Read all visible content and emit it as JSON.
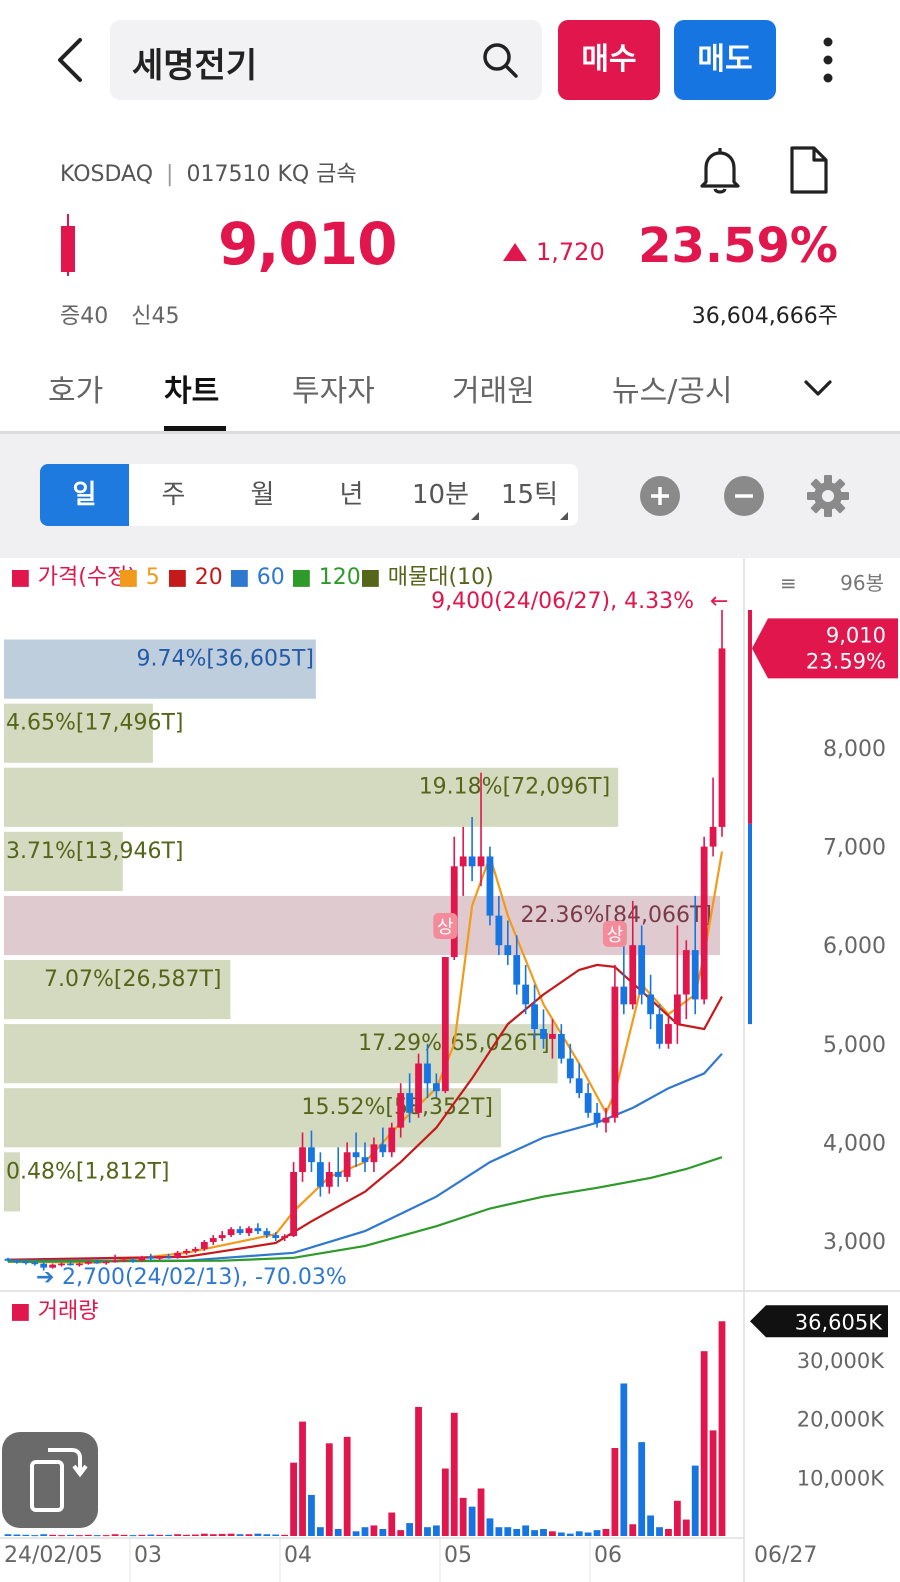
{
  "header": {
    "search_text": "세명전기",
    "buy_label": "매수",
    "sell_label": "매도",
    "icons": [
      "back-arrow-icon",
      "search-icon",
      "more-vertical-icon"
    ]
  },
  "stock": {
    "market": "KOSDAQ",
    "code_line": "017510 KQ 금속",
    "price": "9,010",
    "change": "1,720",
    "change_pct": "23.59%",
    "margin_a": "증40",
    "margin_b": "신45",
    "shares": "36,604,666주",
    "up_color": "#e0164c",
    "down_color": "#1675e0"
  },
  "tabs": [
    {
      "label": "호가",
      "active": false
    },
    {
      "label": "차트",
      "active": true
    },
    {
      "label": "투자자",
      "active": false
    },
    {
      "label": "거래원",
      "active": false
    },
    {
      "label": "뉴스/공시",
      "active": false
    }
  ],
  "periods": [
    {
      "label": "일",
      "active": true,
      "corner": false
    },
    {
      "label": "주",
      "active": false,
      "corner": false
    },
    {
      "label": "월",
      "active": false,
      "corner": false
    },
    {
      "label": "년",
      "active": false,
      "corner": false
    },
    {
      "label": "10분",
      "active": false,
      "corner": true
    },
    {
      "label": "15틱",
      "active": false,
      "corner": true
    }
  ],
  "chart_data": [
    {
      "type": "candlestick",
      "legend": [
        {
          "label": "■ 가격(수정)",
          "color": "#e0164c"
        },
        {
          "label": "■ 5",
          "color": "#f29a1c"
        },
        {
          "label": "■ 20",
          "color": "#c41a1a"
        },
        {
          "label": "■ 60",
          "color": "#2f78d0"
        },
        {
          "label": "■ 120",
          "color": "#2e9a2a"
        },
        {
          "label": "■ 매물대(10)",
          "color": "#55651a"
        }
      ],
      "bar_count_label": "96봉",
      "ylim": [
        2700,
        9600
      ],
      "y_ticks": [
        3000,
        4000,
        5000,
        6000,
        7000,
        8000
      ],
      "y_tick_labels": [
        "3,000",
        "4,000",
        "5,000",
        "6,000",
        "7,000",
        "8,000"
      ],
      "x_tick_labels": [
        "24/02/05",
        "03",
        "04",
        "05",
        "06",
        "06/27"
      ],
      "current_price_label": "9,010",
      "current_pct_label": "23.59%",
      "high_annotation": "9,400(24/06/27), 4.33%",
      "high_arrow": "←",
      "low_annotation": "2,700(24/02/13), -70.03%",
      "low_arrow": "➔",
      "limit_up_marker": "상",
      "volume_profile": [
        {
          "label": "9.74%[36,605T]",
          "low": 8500,
          "high": 9100,
          "share": 9.74,
          "color": "#b7c9d9"
        },
        {
          "label": "4.65%[17,496T]",
          "low": 7850,
          "high": 8450,
          "share": 4.65,
          "color": "#cfd6b8"
        },
        {
          "label": "19.18%[72,096T]",
          "low": 7200,
          "high": 7800,
          "share": 19.18,
          "color": "#cfd6b8"
        },
        {
          "label": "3.71%[13,946T]",
          "low": 6550,
          "high": 7150,
          "share": 3.71,
          "color": "#cfd6b8"
        },
        {
          "label": "22.36%[84,066T]",
          "low": 5900,
          "high": 6500,
          "share": 22.36,
          "color": "#dcc5ca"
        },
        {
          "label": "7.07%[26,587T]",
          "low": 5250,
          "high": 5850,
          "share": 7.07,
          "color": "#cfd6b8"
        },
        {
          "label": "17.29%[65,026T]",
          "low": 4600,
          "high": 5200,
          "share": 17.29,
          "color": "#cfd6b8"
        },
        {
          "label": "15.52%[58,352T]",
          "low": 3950,
          "high": 4550,
          "share": 15.52,
          "color": "#cfd6b8"
        },
        {
          "label": "0.48%[1,812T]",
          "low": 3300,
          "high": 3900,
          "share": 0.48,
          "color": "#cfd6b8"
        }
      ],
      "candles": [
        [
          2820,
          2830,
          2790,
          2800
        ],
        [
          2800,
          2810,
          2770,
          2790
        ],
        [
          2790,
          2800,
          2760,
          2780
        ],
        [
          2780,
          2790,
          2750,
          2770
        ],
        [
          2770,
          2780,
          2700,
          2730
        ],
        [
          2730,
          2770,
          2720,
          2760
        ],
        [
          2760,
          2780,
          2740,
          2770
        ],
        [
          2770,
          2790,
          2750,
          2760
        ],
        [
          2760,
          2780,
          2740,
          2770
        ],
        [
          2770,
          2800,
          2760,
          2790
        ],
        [
          2790,
          2810,
          2770,
          2780
        ],
        [
          2780,
          2800,
          2760,
          2790
        ],
        [
          2790,
          2860,
          2780,
          2800
        ],
        [
          2800,
          2830,
          2790,
          2810
        ],
        [
          2810,
          2830,
          2780,
          2800
        ],
        [
          2800,
          2850,
          2790,
          2840
        ],
        [
          2840,
          2870,
          2800,
          2820
        ],
        [
          2820,
          2850,
          2810,
          2840
        ],
        [
          2840,
          2870,
          2820,
          2830
        ],
        [
          2830,
          2900,
          2820,
          2880
        ],
        [
          2880,
          2920,
          2860,
          2900
        ],
        [
          2900,
          2940,
          2880,
          2920
        ],
        [
          2920,
          3010,
          2900,
          2990
        ],
        [
          2990,
          3060,
          2960,
          3030
        ],
        [
          3030,
          3100,
          3000,
          3060
        ],
        [
          3060,
          3140,
          3040,
          3120
        ],
        [
          3120,
          3150,
          3060,
          3080
        ],
        [
          3080,
          3150,
          3050,
          3130
        ],
        [
          3130,
          3180,
          3070,
          3100
        ],
        [
          3100,
          3130,
          3030,
          3060
        ],
        [
          3060,
          3090,
          3000,
          3030
        ],
        [
          3030,
          3070,
          3000,
          3050
        ],
        [
          3050,
          3800,
          3040,
          3700
        ],
        [
          3700,
          4100,
          3600,
          3950
        ],
        [
          3950,
          4120,
          3700,
          3800
        ],
        [
          3800,
          3900,
          3450,
          3550
        ],
        [
          3550,
          3800,
          3480,
          3700
        ],
        [
          3700,
          3950,
          3550,
          3650
        ],
        [
          3650,
          4000,
          3600,
          3900
        ],
        [
          3900,
          4100,
          3750,
          3850
        ],
        [
          3850,
          4000,
          3700,
          3800
        ],
        [
          3800,
          4050,
          3700,
          3980
        ],
        [
          3980,
          4150,
          3850,
          3900
        ],
        [
          3900,
          4200,
          3850,
          4150
        ],
        [
          4150,
          4600,
          4050,
          4500
        ],
        [
          4500,
          4700,
          4200,
          4300
        ],
        [
          4300,
          4900,
          4250,
          4800
        ],
        [
          4800,
          5000,
          4450,
          4600
        ],
        [
          4600,
          4700,
          4450,
          4520
        ],
        [
          4520,
          5880,
          4500,
          5880
        ],
        [
          5880,
          7100,
          5850,
          6800
        ],
        [
          6800,
          7200,
          6500,
          6900
        ],
        [
          6900,
          7300,
          6650,
          6800
        ],
        [
          6800,
          7750,
          6600,
          6900
        ],
        [
          6900,
          7000,
          6200,
          6300
        ],
        [
          6300,
          6500,
          5900,
          6000
        ],
        [
          6000,
          6250,
          5800,
          5900
        ],
        [
          5900,
          6100,
          5500,
          5600
        ],
        [
          5600,
          5800,
          5300,
          5400
        ],
        [
          5400,
          5600,
          5050,
          5150
        ],
        [
          5150,
          5350,
          4950,
          5050
        ],
        [
          5050,
          5250,
          4850,
          5100
        ],
        [
          5100,
          5200,
          4800,
          4850
        ],
        [
          4850,
          5000,
          4600,
          4650
        ],
        [
          4650,
          4800,
          4450,
          4500
        ],
        [
          4500,
          4600,
          4250,
          4300
        ],
        [
          4300,
          4400,
          4150,
          4200
        ],
        [
          4200,
          4350,
          4100,
          4250
        ],
        [
          4250,
          5800,
          4200,
          5580
        ],
        [
          5580,
          6000,
          5300,
          5400
        ],
        [
          5400,
          6450,
          5350,
          6000
        ],
        [
          6000,
          6200,
          5400,
          5500
        ],
        [
          5500,
          5700,
          5150,
          5300
        ],
        [
          5300,
          5400,
          4950,
          5000
        ],
        [
          5000,
          5300,
          4950,
          5200
        ],
        [
          5200,
          6200,
          5000,
          5500
        ],
        [
          5500,
          6050,
          5250,
          5950
        ],
        [
          5950,
          6500,
          5300,
          5450
        ],
        [
          5450,
          7100,
          5400,
          7000
        ],
        [
          7000,
          7700,
          6900,
          7200
        ],
        [
          7200,
          9400,
          7100,
          9010
        ]
      ],
      "ma_lines": [
        {
          "name": "5",
          "color": "#f29a1c",
          "points": [
            [
              0,
              2790
            ],
            [
              10,
              2780
            ],
            [
              20,
              2880
            ],
            [
              30,
              3070
            ],
            [
              32,
              3300
            ],
            [
              36,
              3650
            ],
            [
              40,
              3800
            ],
            [
              44,
              4200
            ],
            [
              48,
              4550
            ],
            [
              50,
              5000
            ],
            [
              52,
              6400
            ],
            [
              54,
              6900
            ],
            [
              56,
              6300
            ],
            [
              60,
              5400
            ],
            [
              64,
              4800
            ],
            [
              67,
              4300
            ],
            [
              68,
              4500
            ],
            [
              71,
              5600
            ],
            [
              74,
              5300
            ],
            [
              77,
              5500
            ],
            [
              78,
              5900
            ],
            [
              80,
              6950
            ]
          ]
        },
        {
          "name": "20",
          "color": "#c41a1a",
          "points": [
            [
              0,
              2810
            ],
            [
              20,
              2840
            ],
            [
              30,
              2980
            ],
            [
              34,
              3200
            ],
            [
              40,
              3500
            ],
            [
              44,
              3800
            ],
            [
              48,
              4150
            ],
            [
              52,
              4650
            ],
            [
              56,
              5200
            ],
            [
              60,
              5500
            ],
            [
              64,
              5750
            ],
            [
              66,
              5800
            ],
            [
              68,
              5780
            ],
            [
              72,
              5450
            ],
            [
              75,
              5200
            ],
            [
              78,
              5150
            ],
            [
              80,
              5480
            ]
          ]
        },
        {
          "name": "60",
          "color": "#2f78d0",
          "points": [
            [
              0,
              2800
            ],
            [
              20,
              2800
            ],
            [
              32,
              2880
            ],
            [
              40,
              3100
            ],
            [
              48,
              3450
            ],
            [
              54,
              3800
            ],
            [
              60,
              4050
            ],
            [
              66,
              4200
            ],
            [
              70,
              4350
            ],
            [
              74,
              4550
            ],
            [
              78,
              4700
            ],
            [
              80,
              4900
            ]
          ]
        },
        {
          "name": "120",
          "color": "#2e9a2a",
          "points": [
            [
              0,
              2790
            ],
            [
              24,
              2800
            ],
            [
              32,
              2830
            ],
            [
              40,
              2950
            ],
            [
              48,
              3150
            ],
            [
              54,
              3330
            ],
            [
              60,
              3450
            ],
            [
              66,
              3540
            ],
            [
              72,
              3640
            ],
            [
              76,
              3730
            ],
            [
              80,
              3850
            ]
          ]
        }
      ]
    },
    {
      "type": "bar",
      "title": "■ 거래량",
      "current_label": "36,605K",
      "ylim": [
        0,
        38000
      ],
      "y_ticks": [
        10000,
        20000,
        30000
      ],
      "y_tick_labels": [
        "10,000K",
        "20,000K",
        "30,000K"
      ],
      "unit": "K",
      "values": [
        300,
        250,
        200,
        150,
        300,
        200,
        150,
        200,
        150,
        200,
        150,
        150,
        300,
        200,
        150,
        200,
        250,
        200,
        200,
        300,
        200,
        250,
        400,
        300,
        350,
        400,
        300,
        300,
        400,
        300,
        250,
        200,
        12500,
        19500,
        7000,
        1500,
        15800,
        1200,
        16900,
        800,
        1500,
        1800,
        1200,
        4000,
        1000,
        2200,
        22000,
        1500,
        1800,
        11500,
        21000,
        6500,
        5000,
        8100,
        3000,
        1500,
        1500,
        1200,
        1800,
        1000,
        1200,
        800,
        600,
        400,
        800,
        600,
        1000,
        1200,
        15000,
        26000,
        2000,
        16000,
        3500,
        1500,
        1200,
        6000,
        2800,
        12000,
        31500,
        18000,
        36600
      ],
      "up": [
        false,
        false,
        false,
        false,
        false,
        true,
        true,
        false,
        true,
        true,
        false,
        true,
        true,
        true,
        false,
        true,
        false,
        true,
        false,
        true,
        true,
        true,
        true,
        true,
        true,
        true,
        false,
        true,
        false,
        false,
        false,
        true,
        true,
        true,
        false,
        false,
        true,
        false,
        true,
        false,
        false,
        true,
        false,
        true,
        true,
        false,
        true,
        false,
        false,
        true,
        true,
        true,
        false,
        true,
        false,
        false,
        false,
        false,
        false,
        false,
        false,
        true,
        false,
        false,
        false,
        false,
        false,
        true,
        true,
        false,
        true,
        false,
        false,
        false,
        true,
        true,
        true,
        false,
        true,
        true,
        true
      ]
    }
  ]
}
